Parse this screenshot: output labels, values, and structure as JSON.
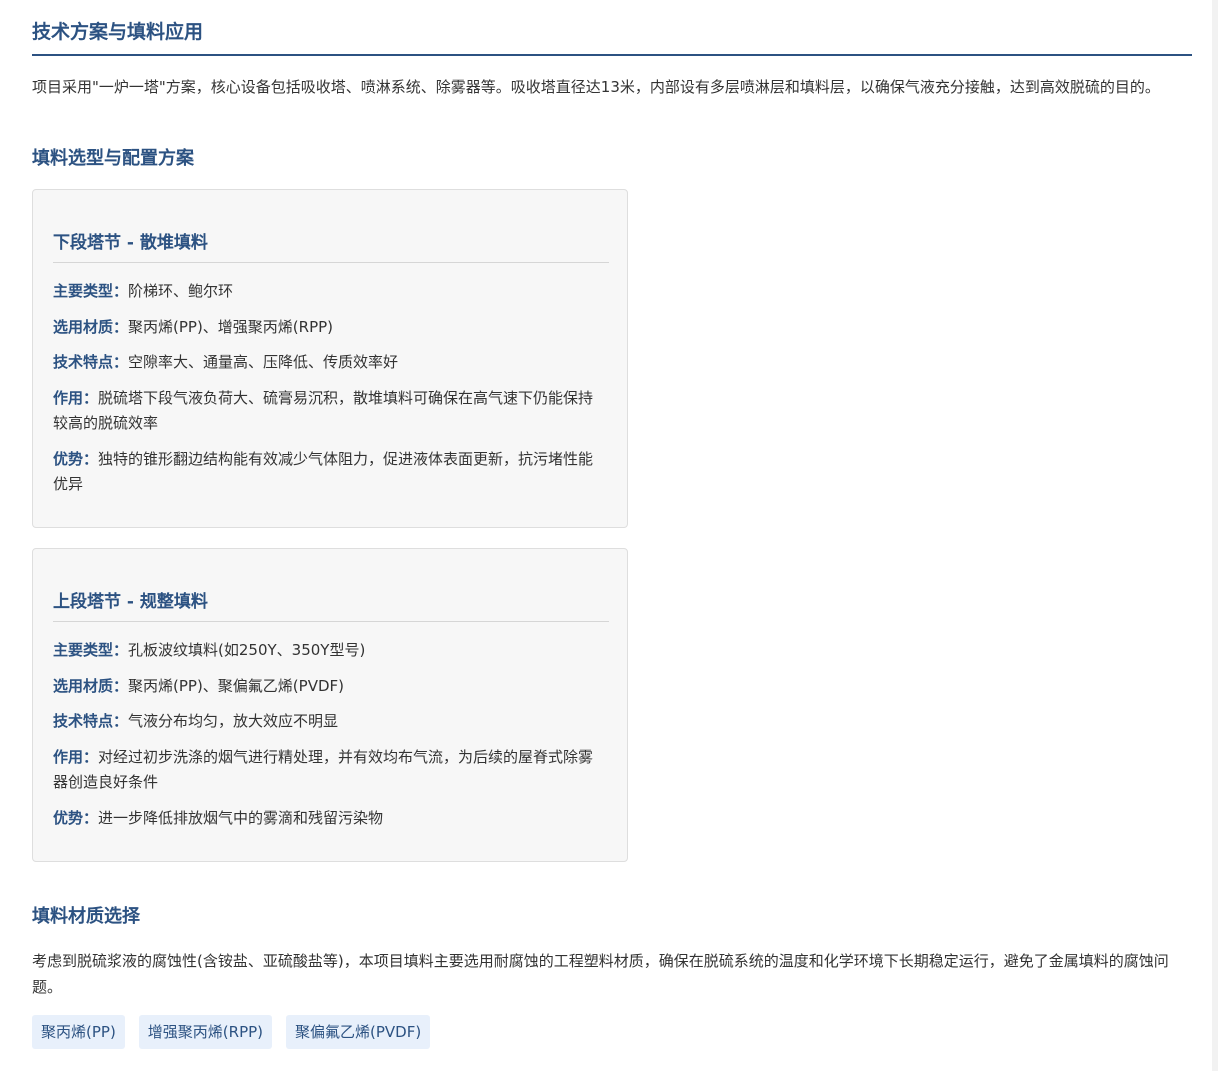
{
  "page": {
    "title": "技术方案与填料应用",
    "intro": "项目采用\"一炉一塔\"方案，核心设备包括吸收塔、喷淋系统、除雾器等。吸收塔直径达13米，内部设有多层喷淋层和填料层，以确保气液充分接触，达到高效脱硫的目的。"
  },
  "packing_selection": {
    "heading": "填料选型与配置方案",
    "cards": [
      {
        "title": "下段塔节 - 散堆填料",
        "rows": [
          {
            "label": "主要类型：",
            "value": "阶梯环、鲍尔环"
          },
          {
            "label": "选用材质：",
            "value": "聚丙烯(PP)、增强聚丙烯(RPP)"
          },
          {
            "label": "技术特点：",
            "value": "空隙率大、通量高、压降低、传质效率好"
          },
          {
            "label": "作用：",
            "value": "脱硫塔下段气液负荷大、硫膏易沉积，散堆填料可确保在高气速下仍能保持较高的脱硫效率"
          },
          {
            "label": "优势：",
            "value": "独特的锥形翻边结构能有效减少气体阻力，促进液体表面更新，抗污堵性能优异"
          }
        ]
      },
      {
        "title": "上段塔节 - 规整填料",
        "rows": [
          {
            "label": "主要类型：",
            "value": "孔板波纹填料(如250Y、350Y型号)"
          },
          {
            "label": "选用材质：",
            "value": "聚丙烯(PP)、聚偏氟乙烯(PVDF)"
          },
          {
            "label": "技术特点：",
            "value": "气液分布均匀，放大效应不明显"
          },
          {
            "label": "作用：",
            "value": "对经过初步洗涤的烟气进行精处理，并有效均布气流，为后续的屋脊式除雾器创造良好条件"
          },
          {
            "label": "优势：",
            "value": "进一步降低排放烟气中的雾滴和残留污染物"
          }
        ]
      }
    ]
  },
  "material_selection": {
    "heading": "填料材质选择",
    "text": "考虑到脱硫浆液的腐蚀性(含铵盐、亚硫酸盐等)，本项目填料主要选用耐腐蚀的工程塑料材质，确保在脱硫系统的温度和化学环境下长期稳定运行，避免了金属填料的腐蚀问题。",
    "tags": [
      "聚丙烯(PP)",
      "增强聚丙烯(RPP)",
      "聚偏氟乙烯(PVDF)"
    ]
  },
  "colors": {
    "accent": "#2c5282",
    "card_bg": "#f7f7f7",
    "tag_bg": "#e8f0fb"
  }
}
